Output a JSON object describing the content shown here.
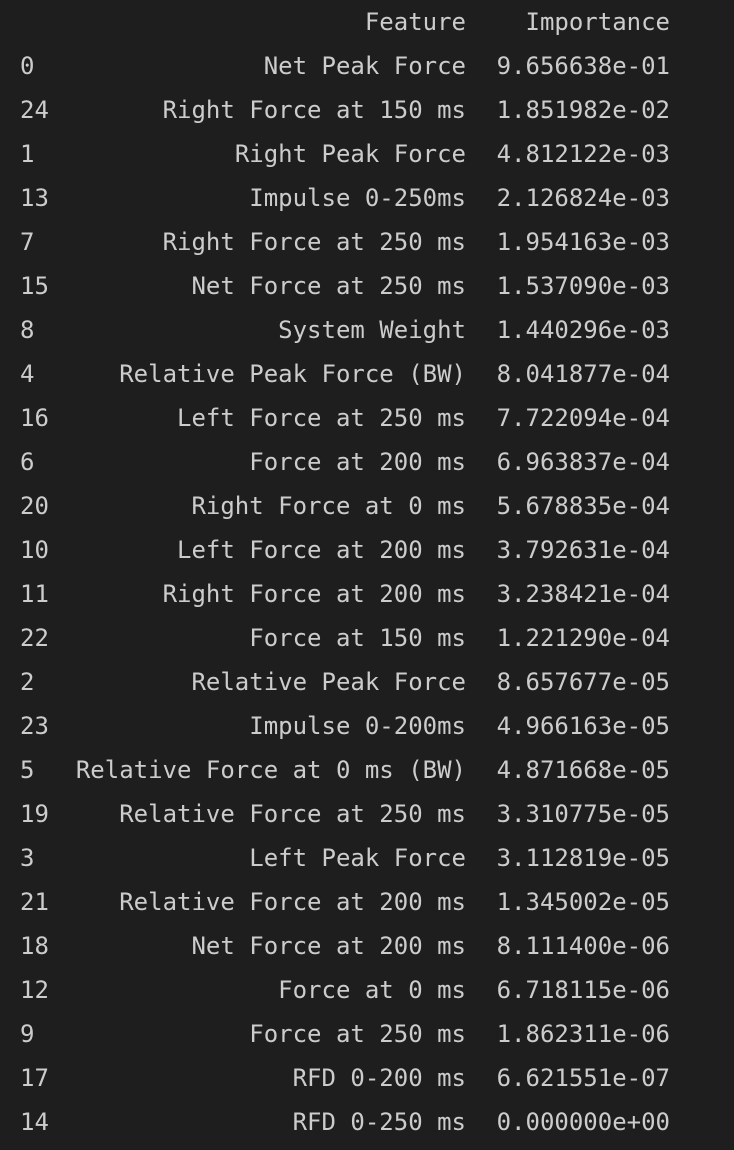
{
  "table": {
    "columns": {
      "index": "",
      "feature": "Feature",
      "importance": "Importance"
    },
    "rows": [
      {
        "index": "0",
        "feature": "Net Peak Force",
        "importance": "9.656638e-01"
      },
      {
        "index": "24",
        "feature": "Right Force at 150 ms",
        "importance": "1.851982e-02"
      },
      {
        "index": "1",
        "feature": "Right Peak Force",
        "importance": "4.812122e-03"
      },
      {
        "index": "13",
        "feature": "Impulse 0-250ms",
        "importance": "2.126824e-03"
      },
      {
        "index": "7",
        "feature": "Right Force at 250 ms",
        "importance": "1.954163e-03"
      },
      {
        "index": "15",
        "feature": "Net Force at 250 ms",
        "importance": "1.537090e-03"
      },
      {
        "index": "8",
        "feature": "System Weight",
        "importance": "1.440296e-03"
      },
      {
        "index": "4",
        "feature": "Relative Peak Force (BW)",
        "importance": "8.041877e-04"
      },
      {
        "index": "16",
        "feature": "Left Force at 250 ms",
        "importance": "7.722094e-04"
      },
      {
        "index": "6",
        "feature": "Force at 200 ms",
        "importance": "6.963837e-04"
      },
      {
        "index": "20",
        "feature": "Right Force at 0 ms",
        "importance": "5.678835e-04"
      },
      {
        "index": "10",
        "feature": "Left Force at 200 ms",
        "importance": "3.792631e-04"
      },
      {
        "index": "11",
        "feature": "Right Force at 200 ms",
        "importance": "3.238421e-04"
      },
      {
        "index": "22",
        "feature": "Force at 150 ms",
        "importance": "1.221290e-04"
      },
      {
        "index": "2",
        "feature": "Relative Peak Force",
        "importance": "8.657677e-05"
      },
      {
        "index": "23",
        "feature": "Impulse 0-200ms",
        "importance": "4.966163e-05"
      },
      {
        "index": "5",
        "feature": "Relative Force at 0 ms (BW)",
        "importance": "4.871668e-05"
      },
      {
        "index": "19",
        "feature": "Relative Force at 250 ms",
        "importance": "3.310775e-05"
      },
      {
        "index": "3",
        "feature": "Left Peak Force",
        "importance": "3.112819e-05"
      },
      {
        "index": "21",
        "feature": "Relative Force at 200 ms",
        "importance": "1.345002e-05"
      },
      {
        "index": "18",
        "feature": "Net Force at 200 ms",
        "importance": "8.111400e-06"
      },
      {
        "index": "12",
        "feature": "Force at 0 ms",
        "importance": "6.718115e-06"
      },
      {
        "index": "9",
        "feature": "Force at 250 ms",
        "importance": "1.862311e-06"
      },
      {
        "index": "17",
        "feature": "RFD 0-200 ms",
        "importance": "6.621551e-07"
      },
      {
        "index": "14",
        "feature": "RFD 0-250 ms",
        "importance": "0.000000e+00"
      }
    ]
  },
  "colors": {
    "background": "#1e1e1e",
    "text": "#cccccc"
  }
}
